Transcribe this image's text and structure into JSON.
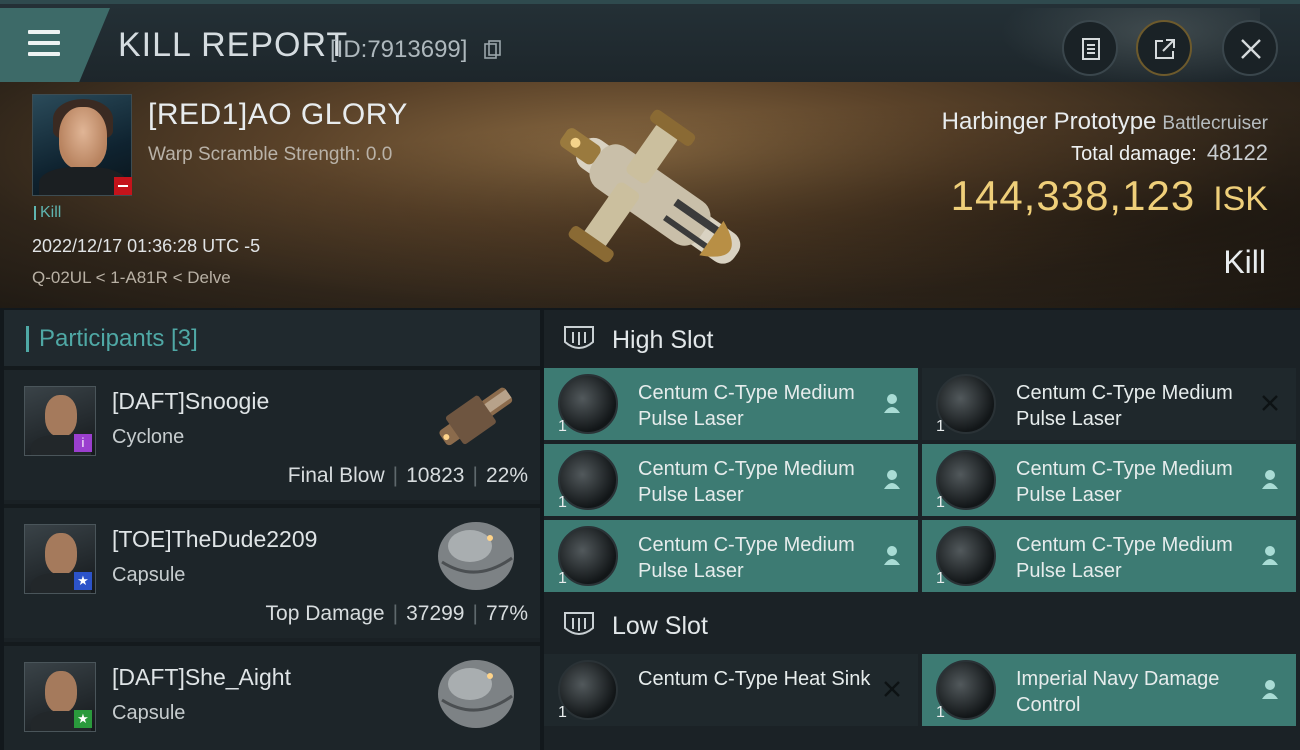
{
  "header": {
    "title": "KILL REPORT",
    "report_id": "[ID:7913699]"
  },
  "victim": {
    "name": "[RED1]AO GLORY",
    "warp_scramble": "Warp Scramble Strength: 0.0",
    "tag": "Kill",
    "datetime": "2022/12/17 01:36:28 UTC -5",
    "location": "Q-02UL < 1-A81R < Delve",
    "ship_name": "Harbinger Prototype",
    "ship_class": "Battlecruiser",
    "total_damage_label": "Total damage:",
    "total_damage": "48122",
    "isk_value": "144,338,123",
    "isk_unit": "ISK",
    "result": "Kill"
  },
  "participants": {
    "title": "Participants [3]",
    "rows": [
      {
        "name": "[DAFT]Snoogie",
        "ship": "Cyclone",
        "label": "Final Blow",
        "damage": "10823",
        "percent": "22%",
        "badge": "i",
        "badge_color": "#9b3fcf"
      },
      {
        "name": "[TOE]TheDude2209",
        "ship": "Capsule",
        "label": "Top Damage",
        "damage": "37299",
        "percent": "77%",
        "badge": "★",
        "badge_color": "#2c53c9"
      },
      {
        "name": "[DAFT]She_Aight",
        "ship": "Capsule",
        "label": "",
        "damage": "",
        "percent": "",
        "badge": "★",
        "badge_color": "#2a9a3c"
      }
    ]
  },
  "fitting": {
    "high_slot_label": "High Slot",
    "low_slot_label": "Low Slot",
    "high": [
      {
        "name": "Centum C-Type Medium Pulse Laser",
        "qty": "1",
        "state": "on",
        "side_icon": "pilot-icon"
      },
      {
        "name": "Centum C-Type Medium Pulse Laser",
        "qty": "1",
        "state": "off",
        "side_icon": "destroyed-x-icon"
      },
      {
        "name": "Centum C-Type Medium Pulse Laser",
        "qty": "1",
        "state": "on",
        "side_icon": "pilot-icon"
      },
      {
        "name": "Centum C-Type Medium Pulse Laser",
        "qty": "1",
        "state": "on",
        "side_icon": "pilot-icon"
      },
      {
        "name": "Centum C-Type Medium Pulse Laser",
        "qty": "1",
        "state": "on",
        "side_icon": "pilot-icon"
      },
      {
        "name": "Centum C-Type Medium Pulse Laser",
        "qty": "1",
        "state": "on",
        "side_icon": "pilot-icon"
      }
    ],
    "low": [
      {
        "name": "Centum C-Type Heat Sink",
        "qty": "1",
        "state": "off",
        "side_icon": "destroyed-x-icon"
      },
      {
        "name": "Imperial Navy Damage Control",
        "qty": "1",
        "state": "on",
        "side_icon": "pilot-icon"
      }
    ]
  }
}
